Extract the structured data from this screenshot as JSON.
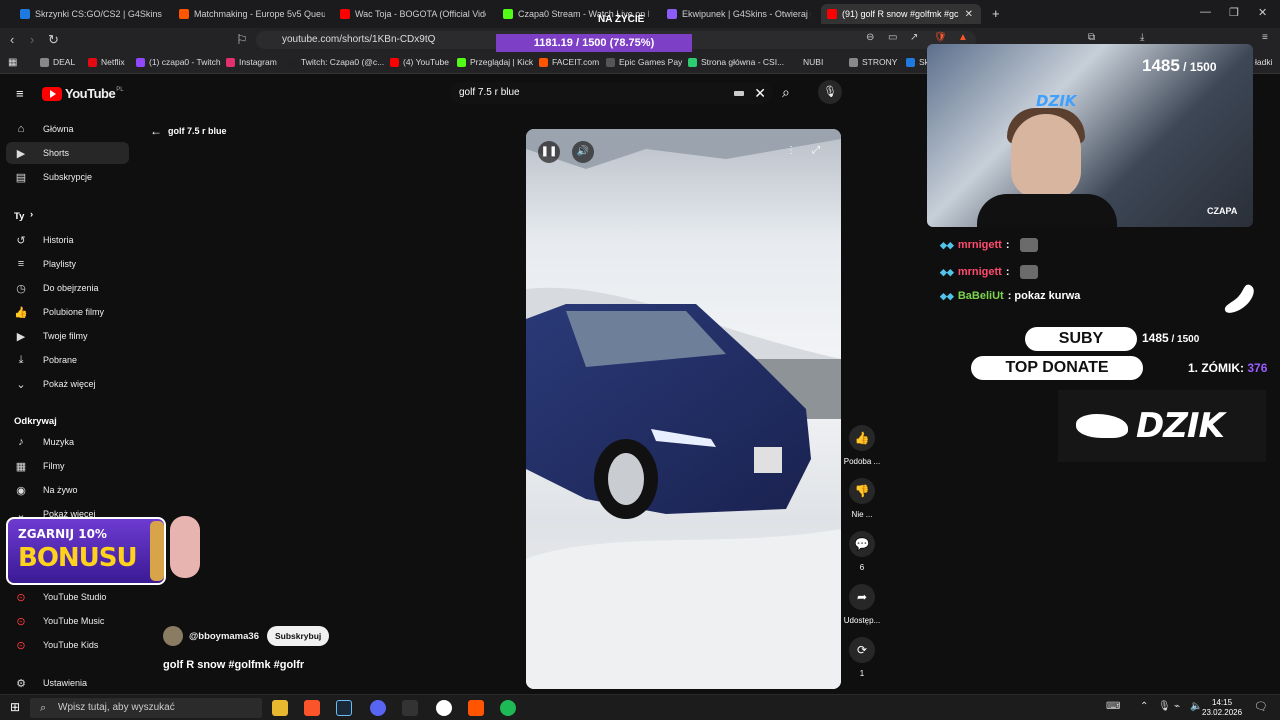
{
  "browser": {
    "tabs": [
      {
        "label": "Skrzynki CS:GO/CS2 | G4Skins Case o",
        "color": "#1f7ae0",
        "active": false
      },
      {
        "label": "Matchmaking - Europe 5v5 Queue - I",
        "color": "#ff5500",
        "active": false
      },
      {
        "label": "Wac Toja - BOGOTA (Official Vide",
        "color": "#ff0000",
        "active": false
      },
      {
        "label": "Czapa0 Stream - Watch Live on Kick",
        "color": "#53fc18",
        "active": false
      },
      {
        "label": "Ekwipunek | G4Skins - Otwieraj skrzy",
        "color": "#8b5cf6",
        "active": false
      },
      {
        "label": "(91) golf R snow #golfmk #gc",
        "color": "#ff0000",
        "active": true
      }
    ],
    "new_tab": "+",
    "url": "youtube.com/shorts/1KBn-CDx9tQ",
    "bookmarks": [
      {
        "label": "DEAL",
        "color": "#888"
      },
      {
        "label": "Netflix",
        "color": "#e50914"
      },
      {
        "label": "(1) czapa0 - Twitch",
        "color": "#9146ff"
      },
      {
        "label": "Instagram",
        "color": "#e1306c"
      },
      {
        "label": "Twitch: Czapa0 (@c...",
        "color": "#222"
      },
      {
        "label": "(4) YouTube",
        "color": "#ff0000"
      },
      {
        "label": "Przeglądaj | Kick",
        "color": "#53fc18"
      },
      {
        "label": "FACEIT.com",
        "color": "#ff5500"
      },
      {
        "label": "Epic Games Pay",
        "color": "#555"
      },
      {
        "label": "Strona główna - CSI...",
        "color": "#2ecc71"
      },
      {
        "label": "NUBI",
        "color": "#777"
      },
      {
        "label": "STRONY",
        "color": "#888"
      },
      {
        "label": "Skrzyn",
        "color": "#1f7ae0"
      },
      {
        "label": "ładki",
        "color": "#888"
      }
    ]
  },
  "youtube": {
    "logo_text": "YouTube",
    "region": "PL",
    "search_value": "golf 7.5 r blue",
    "sidebar": {
      "main": [
        {
          "label": "Główna",
          "icon": "home-icon",
          "glyph": "⌂"
        },
        {
          "label": "Shorts",
          "icon": "shorts-icon",
          "glyph": "▶"
        },
        {
          "label": "Subskrypcje",
          "icon": "subscriptions-icon",
          "glyph": "▤"
        }
      ],
      "you_header": "Ty",
      "you": [
        {
          "label": "Historia",
          "icon": "history-icon",
          "glyph": "↺"
        },
        {
          "label": "Playlisty",
          "icon": "playlists-icon",
          "glyph": "≡"
        },
        {
          "label": "Do obejrzenia",
          "icon": "watch-later-icon",
          "glyph": "◷"
        },
        {
          "label": "Polubione filmy",
          "icon": "liked-icon",
          "glyph": "👍"
        },
        {
          "label": "Twoje filmy",
          "icon": "your-videos-icon",
          "glyph": "▶"
        },
        {
          "label": "Pobrane",
          "icon": "downloads-icon",
          "glyph": "⤓"
        },
        {
          "label": "Pokaż więcej",
          "icon": "chevron-down-icon",
          "glyph": "⌄"
        }
      ],
      "explore_header": "Odkrywaj",
      "explore": [
        {
          "label": "Muzyka",
          "icon": "music-icon",
          "glyph": "♪"
        },
        {
          "label": "Filmy",
          "icon": "movies-icon",
          "glyph": "▦"
        },
        {
          "label": "Na żywo",
          "icon": "live-icon",
          "glyph": "◉"
        },
        {
          "label": "Pokaż więcej",
          "icon": "chevron-down-icon",
          "glyph": "⌄"
        }
      ],
      "more": [
        {
          "label": "YouTube Studio",
          "icon": "youtube-studio-icon"
        },
        {
          "label": "YouTube Music",
          "icon": "youtube-music-icon"
        },
        {
          "label": "YouTube Kids",
          "icon": "youtube-kids-icon"
        }
      ],
      "settings": "Ustawienia"
    },
    "back_label": "golf 7.5 r blue",
    "channel": "@bboymama36",
    "subscribe": "Subskrybuj",
    "video_title": "golf R snow #golfmk #golfr",
    "actions": [
      {
        "label": "Podoba ...",
        "icon": "like-icon",
        "glyph": "👍"
      },
      {
        "label": "Nie ...",
        "icon": "dislike-icon",
        "glyph": "👎"
      },
      {
        "label": "6",
        "icon": "comment-icon",
        "glyph": "💬"
      },
      {
        "label": "Udostęp...",
        "icon": "share-icon",
        "glyph": "➦"
      },
      {
        "label": "1",
        "icon": "remix-icon",
        "glyph": "⟳"
      }
    ]
  },
  "overlay": {
    "na_zycie": "NA ŻYCIE",
    "sub_goal": "1181.19 / 1500 (78.75%)",
    "sub_goal_fraction": 0.7875,
    "bonus_line1": "ZGARNIJ 10%",
    "bonus_line2": "BONUSU",
    "cam_count": "1485",
    "cam_total": " / 1500",
    "cam_badge": "DZIK",
    "cam_name": "CZAPA",
    "chat": [
      {
        "user": "mrnigett",
        "msg": ":",
        "green": false
      },
      {
        "user": "mrnigett",
        "msg": ":",
        "green": false
      },
      {
        "user": "BaBeliUt",
        "msg": ": pokaz kurwa",
        "green": true
      }
    ],
    "subs_label": "SUBY",
    "subs_count": "1485",
    "subs_total": " / 1500",
    "top_donate_label": "TOP DONATE",
    "top_donate_name": "1. ZÓMIK: ",
    "top_donate_amount": "376",
    "logo_text": "DZIK"
  },
  "taskbar": {
    "search_placeholder": "Wpisz tutaj, aby wyszukać",
    "time": "14:15",
    "date": "23.02.2026"
  }
}
